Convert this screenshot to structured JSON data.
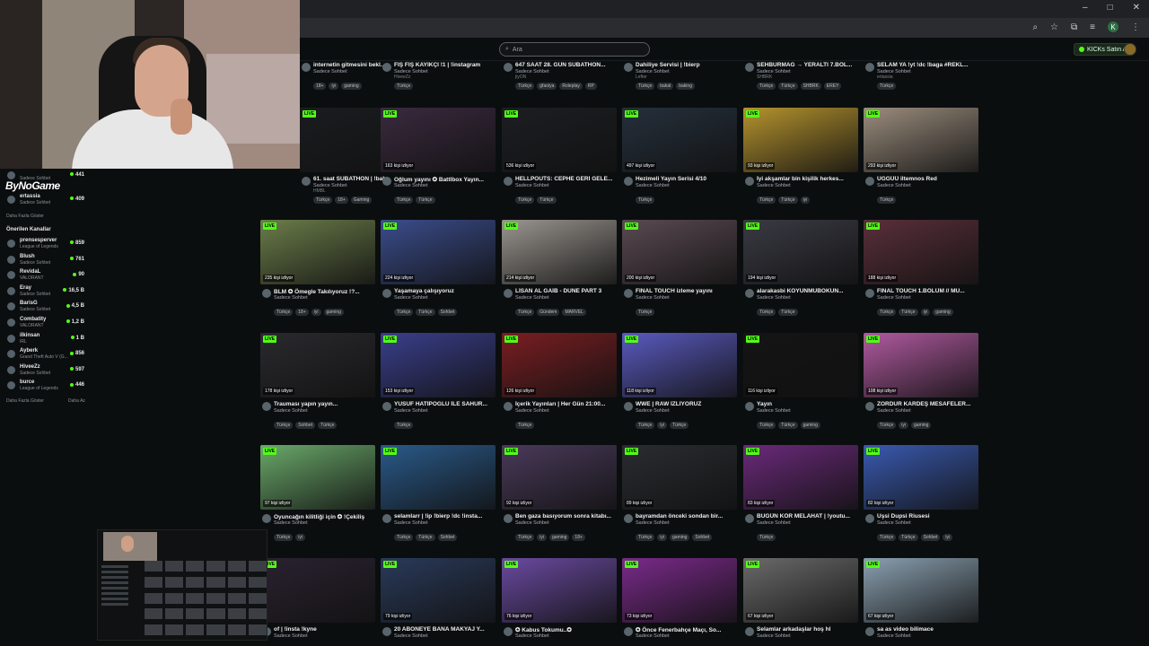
{
  "browser": {
    "window_controls": [
      "–",
      "□",
      "✕"
    ],
    "profile_initial": "K"
  },
  "header": {
    "search_placeholder": "Ara",
    "kicks_button": "KICKs Satın Al"
  },
  "overlay": {
    "logo_text": "ByNoGame"
  },
  "sidebar": {
    "followed_top": [
      {
        "name": "",
        "category": "Sadece Sohbet",
        "viewers": "441"
      },
      {
        "name": "ertassia",
        "category": "Sadece Sohbet",
        "viewers": "409"
      }
    ],
    "show_more_1": "Daha Fazla Göster",
    "recommended_heading": "Önerilen Kanallar",
    "recommended": [
      {
        "name": "prensesperver",
        "category": "League of Legends",
        "viewers": "859"
      },
      {
        "name": "Blush",
        "category": "Sadece Sohbet",
        "viewers": "761"
      },
      {
        "name": "RevidaL",
        "category": "VALORANT",
        "viewers": "90"
      },
      {
        "name": "Eray",
        "category": "Sadece Sohbet",
        "viewers": "16,5 B"
      },
      {
        "name": "BarisG",
        "category": "Sadece Sohbet",
        "viewers": "4,5 B"
      },
      {
        "name": "Combatity",
        "category": "VALORANT",
        "viewers": "1,2 B"
      },
      {
        "name": "ilkinsan",
        "category": "IRL",
        "viewers": "1 B"
      },
      {
        "name": "Ayberk",
        "category": "Grand Theft Auto V (G...",
        "viewers": "856"
      },
      {
        "name": "HiveeZz",
        "category": "Sadece Sohbet",
        "viewers": "597"
      },
      {
        "name": "burce",
        "category": "League of Legends",
        "viewers": "446"
      }
    ],
    "show_more_2": "Daha Fazla Göster",
    "show_less": "Daha Az"
  },
  "grid": {
    "top_row": [
      {
        "title": "internetin gitmesini bekl...",
        "category": "Sadece Sohbet",
        "user": "",
        "tags": [
          "18+",
          "iyi",
          "gaming"
        ]
      },
      {
        "title": "FIŞ FIŞ KAYIKÇI !1 | !instagram",
        "category": "Sadece Sohbet",
        "user": "HiveeZz",
        "tags": [
          "Türkçe"
        ]
      },
      {
        "title": "647 SAAT 28. GÜN SUBATHON...",
        "category": "Sadece Sohbet",
        "user": "jiyON",
        "tags": [
          "Türkçe",
          "gfaoiya",
          "Roleplay",
          "RP"
        ]
      },
      {
        "title": "Dahiliye Servisi | !bierp",
        "category": "Sadece Sohbet",
        "user": "Lefter",
        "tags": [
          "Türkçe",
          "bakal",
          "baking"
        ]
      },
      {
        "title": "SEHBURMAG → YERALTI 7.BÖL...",
        "category": "Sadece Sohbet",
        "user": "SHBRK",
        "tags": [
          "Türkçe",
          "Türkçe",
          "SHBRK",
          "EREY"
        ]
      },
      {
        "title": "SELAM YA !yt !dc !baga #REKL...",
        "category": "Sadece Sohbet",
        "user": "ertassia",
        "tags": [
          "Türkçe"
        ]
      }
    ],
    "rows": [
      [
        {
          "title": "61. saat SUBATHON | !bahs",
          "category": "Sadece Sohbet",
          "user": "HMBL",
          "viewers": "",
          "tags": [
            "Türkçe",
            "18+",
            "Gaming"
          ]
        },
        {
          "title": "Oğlum yayını ✪ Battlbox Yayın...",
          "category": "Sadece Sohbet",
          "user": "",
          "viewers": "163 kişi izliyor",
          "tags": [
            "Türkçe",
            "Türkçe"
          ]
        },
        {
          "title": "HELLPOUTS: CEPHE GERİ GELE...",
          "category": "Sadece Sohbet",
          "user": "",
          "viewers": "536 kişi izliyor",
          "tags": [
            "Türkçe",
            "Türkçe"
          ]
        },
        {
          "title": "Hezimeli Yayın Serisi 4/10",
          "category": "Sadece Sohbet",
          "user": "",
          "viewers": "497 kişi izliyor",
          "tags": [
            "Türkçe"
          ]
        },
        {
          "title": "İyi akşamlar bin kişilik herkes...",
          "category": "Sadece Sohbet",
          "user": "",
          "viewers": "93 kişi izliyor",
          "tags": [
            "Türkçe",
            "Türkçe",
            "iyi"
          ]
        },
        {
          "title": "UĞĞÜÜ iltemnos Red",
          "category": "Sadece Sohbet",
          "user": "",
          "viewers": "293 kişi izliyor",
          "tags": [
            "Türkçe"
          ]
        }
      ],
      [
        {
          "title": "BLM ✪ Ömegle Takılıyoruz !?...",
          "category": "Sadece Sohbet",
          "user": "",
          "viewers": "235 kişi izliyor",
          "tags": [
            "Türkçe",
            "18+",
            "iyi",
            "gaming"
          ]
        },
        {
          "title": "Yaşamaya çalışıyoruz",
          "category": "Sadece Sohbet",
          "user": "",
          "viewers": "224 kişi izliyor",
          "tags": [
            "Türkçe",
            "Türkçe",
            "Sohbet"
          ]
        },
        {
          "title": "LİSAN AL GAİB - DUNE PART 3",
          "category": "Sadece Sohbet",
          "user": "",
          "viewers": "214 kişi izliyor",
          "tags": [
            "Türkçe",
            "Gündem",
            "MARVEL"
          ]
        },
        {
          "title": "FINAL TOUCH izleme yayını",
          "category": "Sadece Sohbet",
          "user": "",
          "viewers": "200 kişi izliyor",
          "tags": [
            "Türkçe"
          ]
        },
        {
          "title": "alarakasbi KOYUNMUBOKUN...",
          "category": "Sadece Sohbet",
          "user": "",
          "viewers": "194 kişi izliyor",
          "tags": [
            "Türkçe",
            "Türkçe"
          ]
        },
        {
          "title": "FINAL TOUCH 1.BÖLÜM // MU...",
          "category": "Sadece Sohbet",
          "user": "",
          "viewers": "188 kişi izliyor",
          "tags": [
            "Türkçe",
            "Türkçe",
            "iyi",
            "gaming"
          ]
        }
      ],
      [
        {
          "title": "Trauması yapın yayın...",
          "category": "Sadece Sohbet",
          "user": "",
          "viewers": "178 kişi izliyor",
          "tags": [
            "Türkçe",
            "Sohbet",
            "Türkçe"
          ]
        },
        {
          "title": "YUSUF HATİPOĞLU İLE SAHUR...",
          "category": "Sadece Sohbet",
          "user": "",
          "viewers": "153 kişi izliyor",
          "tags": [
            "Türkçe"
          ]
        },
        {
          "title": "İçerik Yayınları | Her Gün 21:00...",
          "category": "Sadece Sohbet",
          "user": "",
          "viewers": "126 kişi izliyor",
          "tags": [
            "Türkçe"
          ]
        },
        {
          "title": "WWE | RAW İZLİYORUZ",
          "category": "Sadece Sohbet",
          "user": "",
          "viewers": "118 kişi izliyor",
          "tags": [
            "Türkçe",
            "iyi",
            "Türkçe"
          ]
        },
        {
          "title": "Yayın",
          "category": "Sadece Sohbet",
          "user": "",
          "viewers": "116 kişi izliyor",
          "tags": [
            "Türkçe",
            "Türkçe",
            "gaming"
          ]
        },
        {
          "title": "ZORDUR KARDEŞ MESAFELER...",
          "category": "Sadece Sohbet",
          "user": "",
          "viewers": "108 kişi izliyor",
          "tags": [
            "Türkçe",
            "iyi",
            "gaming"
          ]
        }
      ],
      [
        {
          "title": "Oyuncağın kilitliği için ✪ !Çekiliş",
          "category": "Sadece Sohbet",
          "user": "",
          "viewers": "97 kişi izliyor",
          "tags": [
            "Türkçe",
            "iyi"
          ]
        },
        {
          "title": "selamlarr | !ip !bierp !dc !insta...",
          "category": "Sadece Sohbet",
          "user": "",
          "viewers": "",
          "tags": [
            "Türkçe",
            "Türkçe",
            "Sohbet"
          ]
        },
        {
          "title": "Ben gaza basıyorum sonra kitabı...",
          "category": "Sadece Sohbet",
          "user": "",
          "viewers": "92 kişi izliyor",
          "tags": [
            "Türkçe",
            "iyi",
            "gaming",
            "18+"
          ]
        },
        {
          "title": "bayramdan önceki sondan bir...",
          "category": "Sadece Sohbet",
          "user": "",
          "viewers": "89 kişi izliyor",
          "tags": [
            "Türkçe",
            "iyi",
            "gaming",
            "Sohbet"
          ]
        },
        {
          "title": "BUGÜN KÖR MELAHAT | !youtu...",
          "category": "Sadece Sohbet",
          "user": "",
          "viewers": "83 kişi izliyor",
          "tags": [
            "Türkçe"
          ]
        },
        {
          "title": "Uşsi Dupsi Riusesi",
          "category": "Sadece Sohbet",
          "user": "",
          "viewers": "82 kişi izliyor",
          "tags": [
            "Türkçe",
            "Türkçe",
            "Sohbet",
            "iyi"
          ]
        }
      ],
      [
        {
          "title": "of | !insta !kyne",
          "category": "Sadece Sohbet",
          "user": "",
          "viewers": "",
          "tags": []
        },
        {
          "title": "20 ABONEYE BANA MAKYAJ Y...",
          "category": "Sadece Sohbet",
          "user": "",
          "viewers": "79 kişi izliyor",
          "tags": []
        },
        {
          "title": "✪ Kabus Tokumu..✪",
          "category": "Sadece Sohbet",
          "user": "",
          "viewers": "76 kişi izliyor",
          "tags": []
        },
        {
          "title": "✪ Önce Fenerbahçe Maçı, So...",
          "category": "Sadece Sohbet",
          "user": "",
          "viewers": "73 kişi izliyor",
          "tags": []
        },
        {
          "title": "Selamlar arkadaşlar hoş hl",
          "category": "Sadece Sohbet",
          "user": "",
          "viewers": "67 kişi izliyor",
          "tags": []
        },
        {
          "title": "sa as video bilimace",
          "category": "Sadece Sohbet",
          "user": "",
          "viewers": "67 kişi izliyor",
          "tags": []
        }
      ]
    ],
    "live_label": "LIVE"
  },
  "thumb_colors": [
    [
      "#1a1c1f",
      "#3a2a3f",
      "#1c1e22",
      "#25303c",
      "#b5932e",
      "#9b8d7d"
    ],
    [
      "#6b7d4a",
      "#3b4d8c",
      "#9a958f",
      "#5a4a52",
      "#3a3a44",
      "#5a2f3a"
    ],
    [
      "#2a2a2e",
      "#3a3f8c",
      "#7a1e22",
      "#5a5ac0",
      "#141414",
      "#b05aa0"
    ],
    [
      "#6aa86a",
      "#2a5a8a",
      "#4a3a5a",
      "#2a2c30",
      "#6a2a7a",
      "#3a5ab0"
    ],
    [
      "#2a2230",
      "#2a3a5a",
      "#6a4aa0",
      "#7a2a8a",
      "#6a6a6a",
      "#8aa0b0"
    ]
  ],
  "accent_color": "#53fc18"
}
